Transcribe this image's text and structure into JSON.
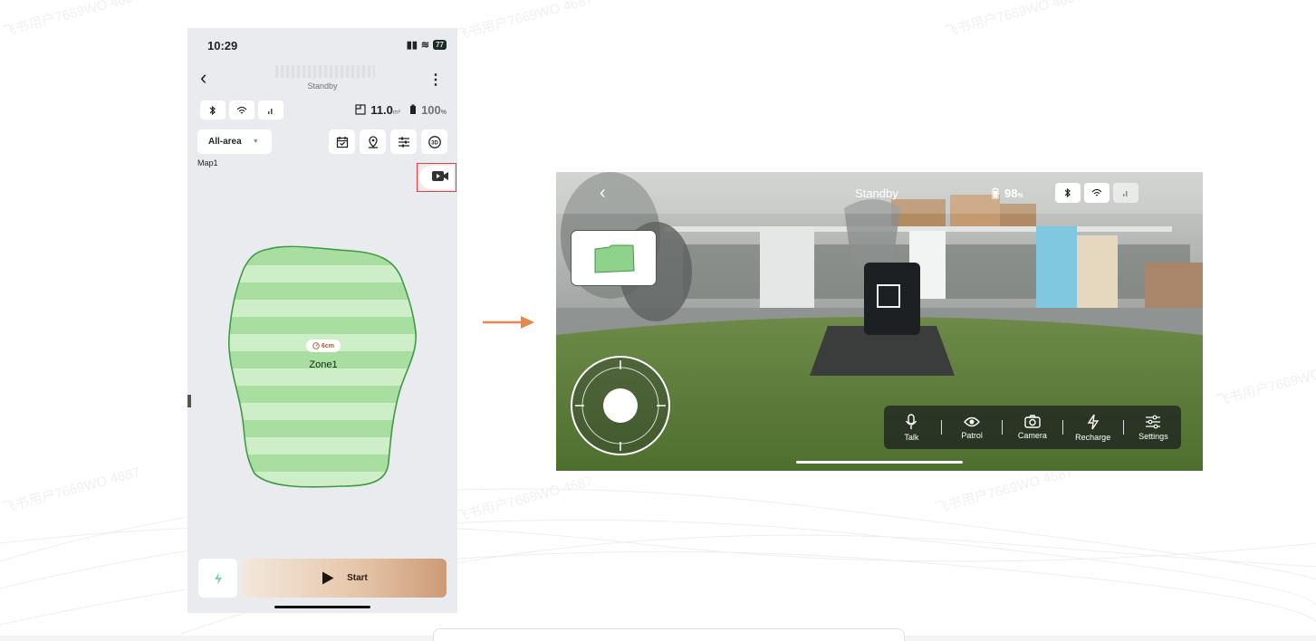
{
  "phone": {
    "status": {
      "time": "10:29",
      "battery": "77"
    },
    "header": {
      "subtitle": "Standby"
    },
    "info": {
      "area": "11.0",
      "area_unit": "m²",
      "battery": "100",
      "battery_unit": "%"
    },
    "zone_select": {
      "value": "All-area"
    },
    "map_label": "Map1",
    "zone": {
      "height": "6cm",
      "name": "Zone1"
    },
    "start_label": "Start"
  },
  "camera": {
    "status_label": "Standby",
    "battery": "98",
    "battery_unit": "%",
    "toolbar": [
      {
        "label": "Talk",
        "icon": "microphone-icon"
      },
      {
        "label": "Patrol",
        "icon": "eye-icon"
      },
      {
        "label": "Camera",
        "icon": "camera-icon"
      },
      {
        "label": "Recharge",
        "icon": "lightning-icon"
      },
      {
        "label": "Settings",
        "icon": "sliders-icon"
      }
    ]
  },
  "watermark": "飞书用户7669WO 4687",
  "colors": {
    "lawn": "#a8dfa0",
    "lawn_border": "#3f9a45",
    "accent_orange": "#e8874a",
    "highlight_red": "#e04040"
  }
}
